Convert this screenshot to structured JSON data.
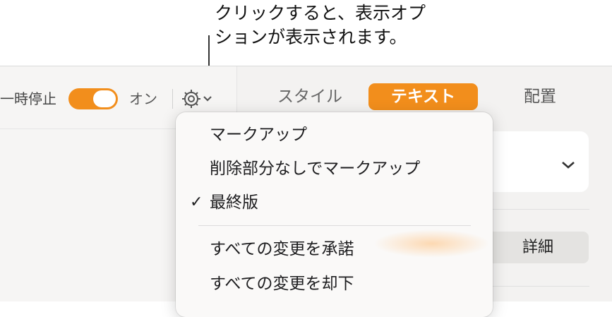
{
  "callout": {
    "line1": "クリックすると、表示オプ",
    "line2": "ションが表示されます。"
  },
  "toolbar": {
    "pause_label": "一時停止",
    "toggle_state": "on",
    "on_label": "オン",
    "view_options_icon": "gear-chevron-icon"
  },
  "tabs": [
    {
      "label": "スタイル",
      "selected": false
    },
    {
      "label": "テキスト",
      "selected": true
    },
    {
      "label": "配置",
      "selected": false
    }
  ],
  "accent_color": "#f28e1c",
  "menu": {
    "items": [
      {
        "label": "マークアップ",
        "checked": false
      },
      {
        "label": "削除部分なしでマークアップ",
        "checked": false
      },
      {
        "label": "最終版",
        "checked": true
      },
      {
        "label": "すべての変更を承諾",
        "checked": false
      },
      {
        "label": "すべての変更を却下",
        "checked": false
      }
    ],
    "check_glyph": "✓"
  },
  "sidebar_right": {
    "details_label": "詳細"
  }
}
